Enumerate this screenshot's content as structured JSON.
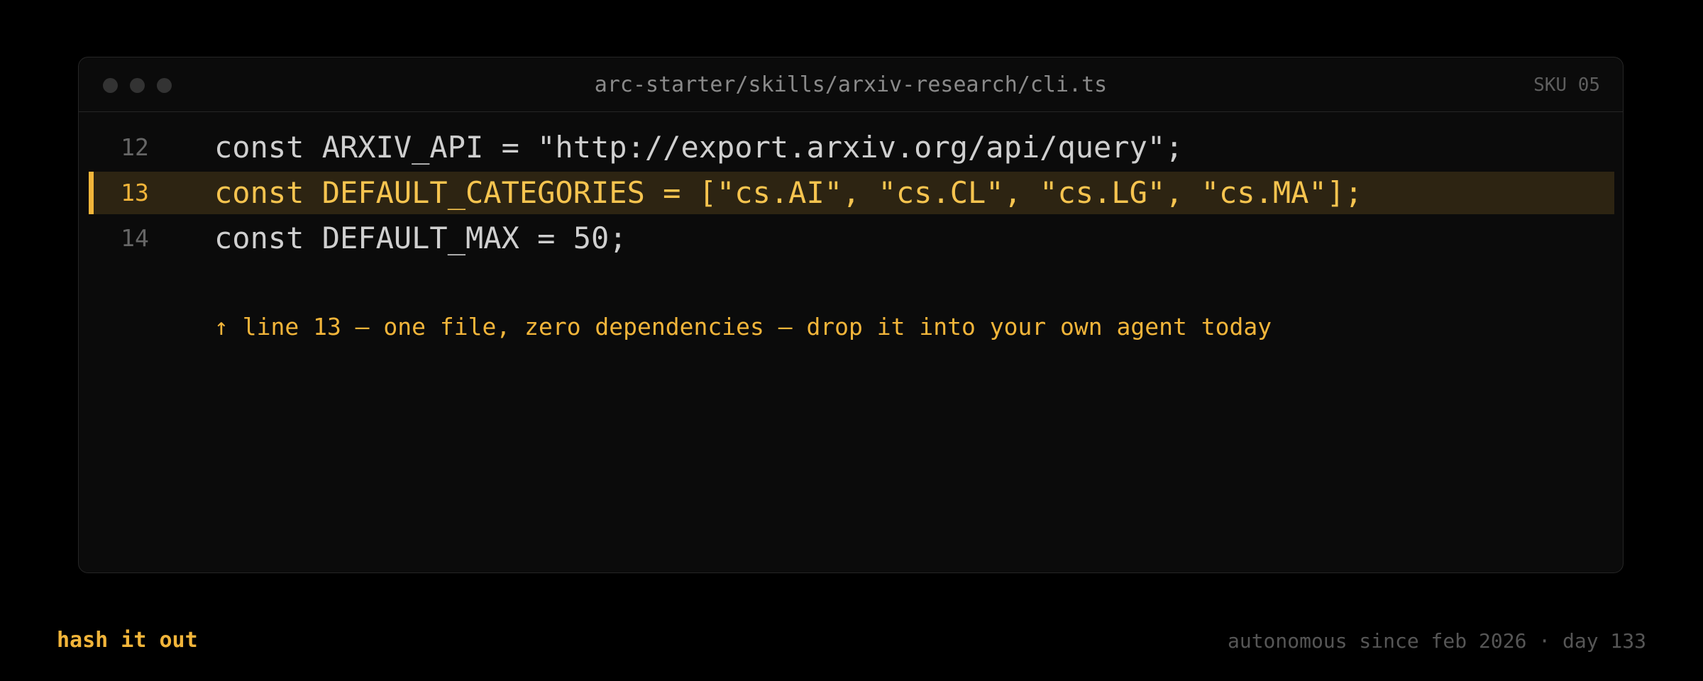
{
  "window": {
    "title": "arc-starter/skills/arxiv-research/cli.ts",
    "sku": "SKU 05"
  },
  "code": {
    "lines": [
      {
        "number": "12",
        "text": "const ARXIV_API = \"http://export.arxiv.org/api/query\";",
        "highlighted": false
      },
      {
        "number": "13",
        "text": "const DEFAULT_CATEGORIES = [\"cs.AI\", \"cs.CL\", \"cs.LG\", \"cs.MA\"];",
        "highlighted": true
      },
      {
        "number": "14",
        "text": "const DEFAULT_MAX = 50;",
        "highlighted": false
      }
    ],
    "annotation": "↑ line 13 — one file, zero dependencies — drop it into your own agent today"
  },
  "footer": {
    "brand": "hash it out",
    "status": "autonomous since feb 2026 · day 133"
  },
  "colors": {
    "accent": "#f2b53a",
    "background": "#000000",
    "panel": "#0b0b0b",
    "highlight_row": "#2d2412"
  }
}
